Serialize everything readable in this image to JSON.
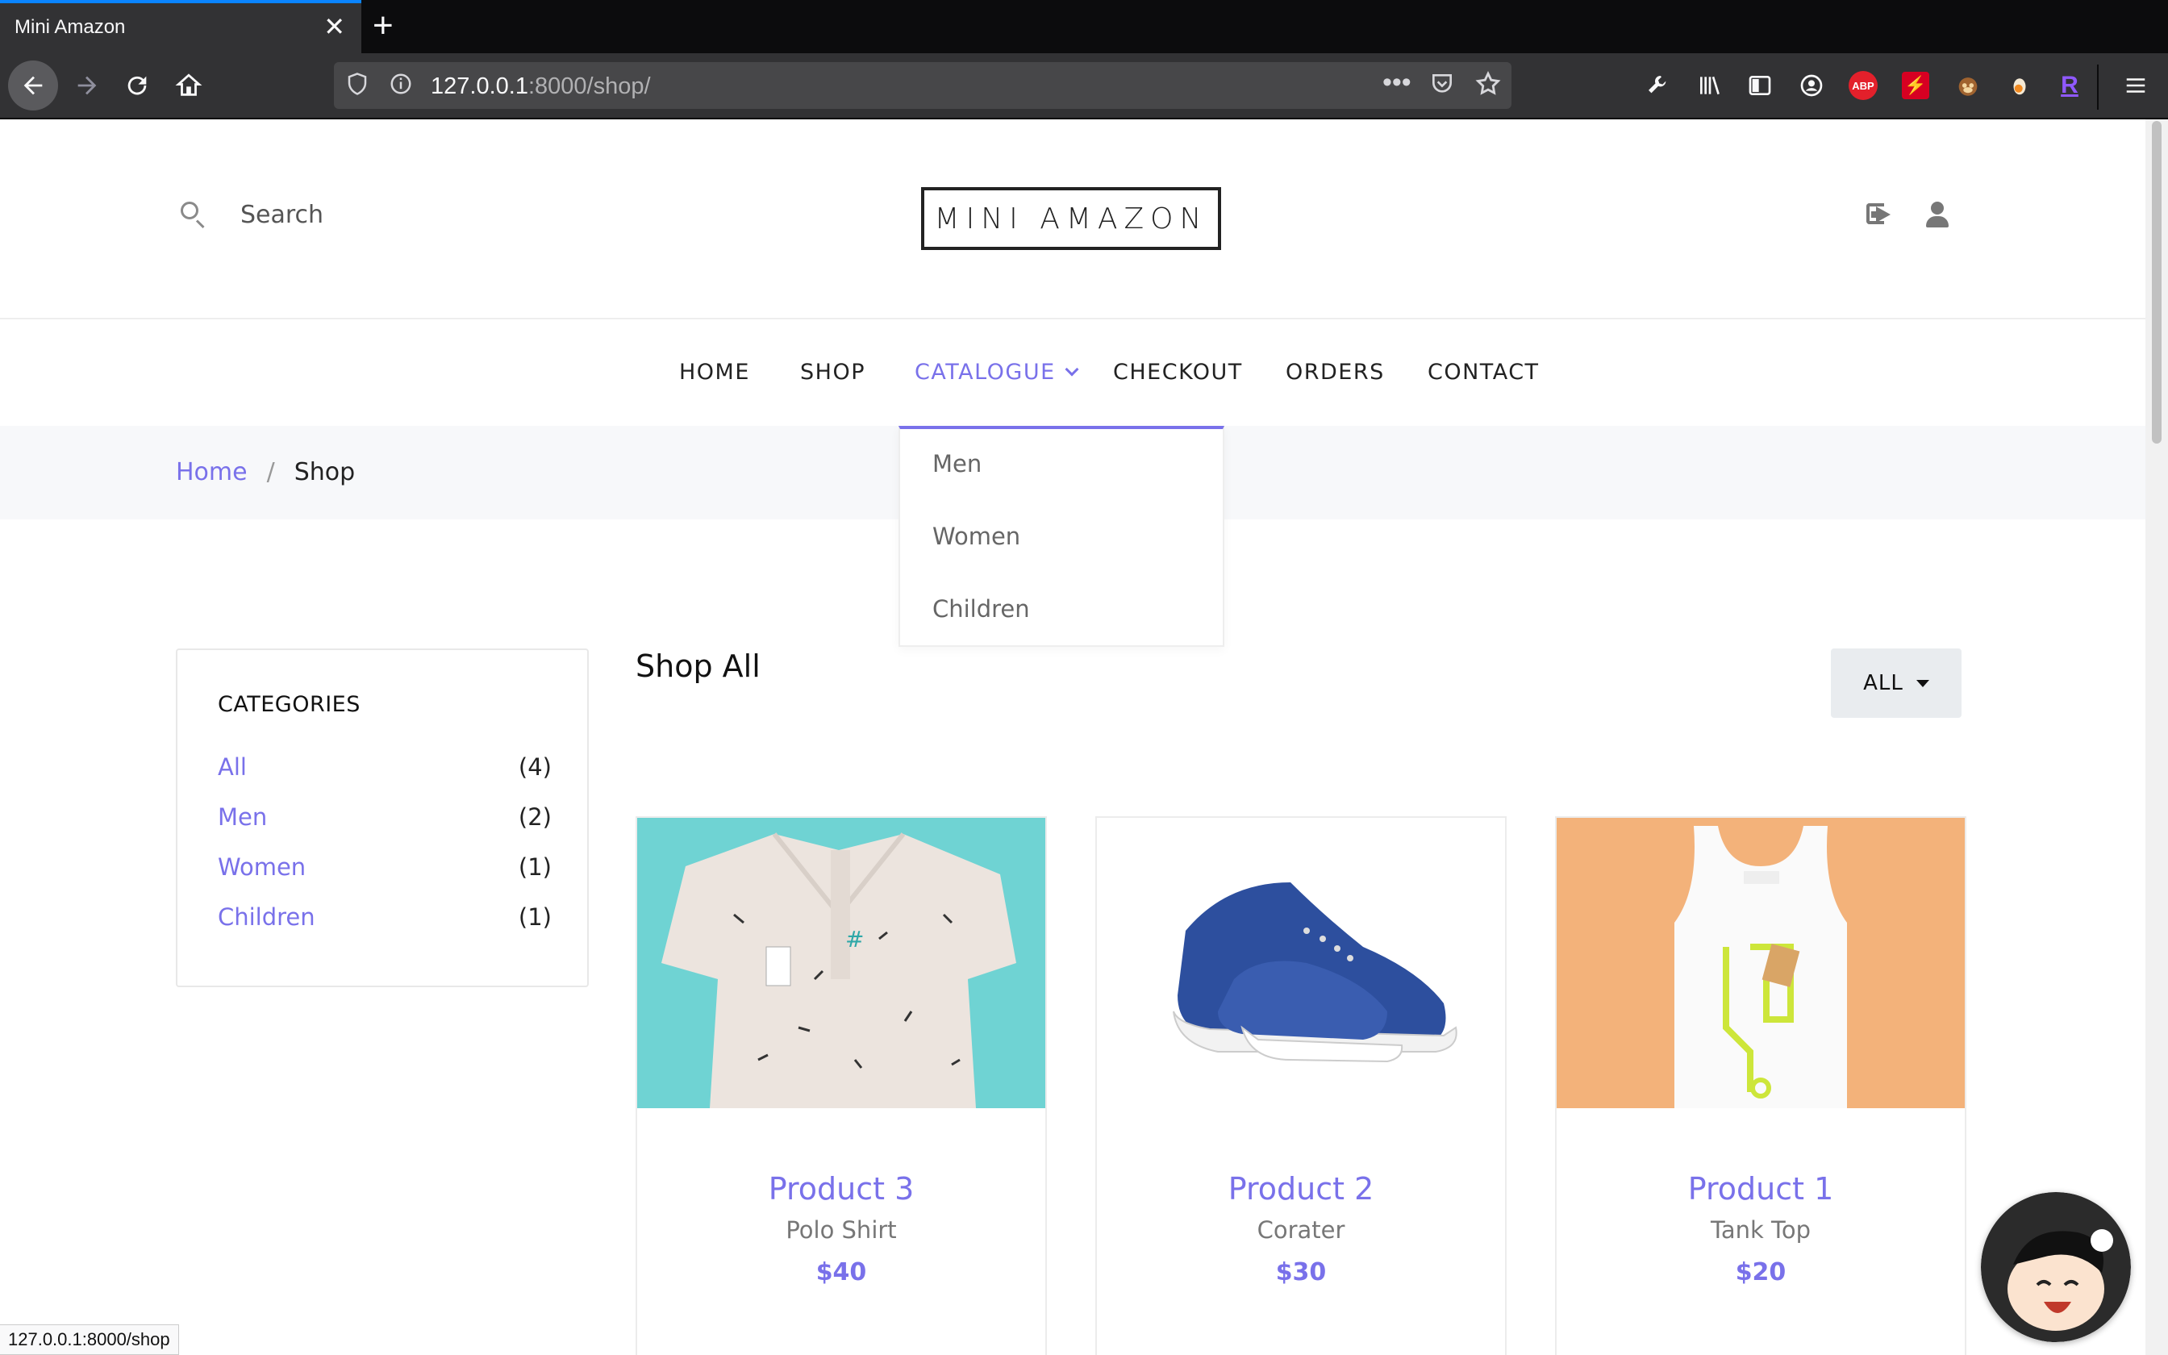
{
  "browser": {
    "tab_title": "Mini Amazon",
    "tab_close": "✕",
    "new_tab": "+",
    "url_host": "127.0.0.1",
    "url_rest": ":8000/shop/",
    "status_url": "127.0.0.1:8000/shop",
    "abp_label": "ABP",
    "r_label": "R",
    "accent_color": "#0a84ff"
  },
  "header": {
    "search_placeholder": "Search",
    "logo": "MINI AMAZON"
  },
  "nav": {
    "items": [
      "HOME",
      "SHOP",
      "CATALOGUE",
      "CHECKOUT",
      "ORDERS",
      "CONTACT"
    ],
    "active": "CATALOGUE",
    "dropdown": [
      "Men",
      "Women",
      "Children"
    ]
  },
  "breadcrumb": {
    "home": "Home",
    "separator": "/",
    "current": "Shop"
  },
  "sidebar": {
    "title": "CATEGORIES",
    "categories": [
      {
        "name": "All",
        "count": "(4)"
      },
      {
        "name": "Men",
        "count": "(2)"
      },
      {
        "name": "Women",
        "count": "(1)"
      },
      {
        "name": "Children",
        "count": "(1)"
      }
    ]
  },
  "main": {
    "title": "Shop All",
    "filter_label": "ALL"
  },
  "products": [
    {
      "name": "Product 3",
      "type": "Polo Shirt",
      "price": "$40",
      "image": "polo-shirt-image"
    },
    {
      "name": "Product 2",
      "type": "Corater",
      "price": "$30",
      "image": "sneaker-image"
    },
    {
      "name": "Product 1",
      "type": "Tank Top",
      "price": "$20",
      "image": "tank-top-image"
    }
  ],
  "colors": {
    "brand_accent": "#7971ea",
    "breadcrumb_bg": "#f7f8fa"
  }
}
